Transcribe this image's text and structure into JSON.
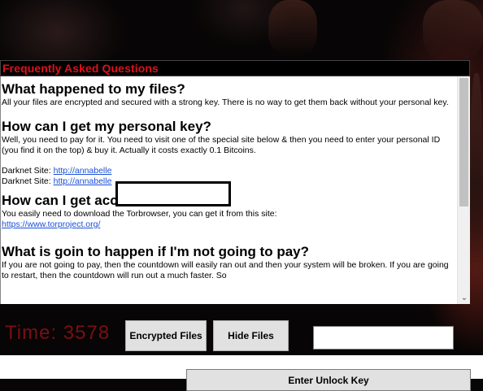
{
  "faq": {
    "title": "Frequently Asked Questions",
    "sections": [
      {
        "heading": "What happened to my files?",
        "body": "All your files are encrypted and secured with a strong key. There is no way to get them back without your personal key."
      },
      {
        "heading": "How can I get my personal key?",
        "body": "Well, you need to pay for it. You need to visit one of the special site below & then you need to enter your personal ID (you find it on the top) & buy it. Actually it costs exactly 0.1 Bitcoins."
      },
      {
        "heading": "How can I get access to the site?",
        "body": "You easily need to download the Torbrowser, you can get it from this site:"
      },
      {
        "heading": "What is goin to happen if I'm not going to pay?",
        "body": "If you are not going to pay, then the countdown will easily ran out and then your system will be broken. If you are going to restart, then the countdown will run out a much faster. So"
      }
    ],
    "darknet": [
      {
        "label": "Darknet Site:",
        "link": "http://annabelle"
      },
      {
        "label": "Darknet Site:",
        "link": "http://annabelle"
      }
    ],
    "tor_link": "https://www.torproject.org/"
  },
  "controls": {
    "timer": "Time: 3578",
    "encrypted_files_label": "Encrypted Files",
    "hide_files_label": "Hide Files",
    "key_input_value": "",
    "enter_unlock_key_label": "Enter Unlock Key"
  },
  "colors": {
    "header_text": "#e0101a",
    "timer_text": "#7a0f14",
    "link": "#1a4fd8"
  },
  "icons": {
    "scroll_down": "chevron-down-icon"
  }
}
